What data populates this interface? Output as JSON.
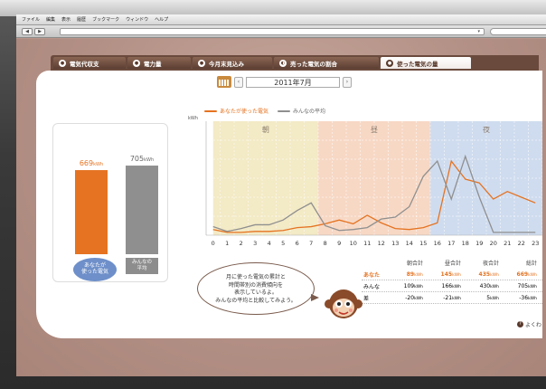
{
  "menu": [
    "ファイル",
    "編集",
    "表示",
    "履歴",
    "ブックマーク",
    "ウィンドウ",
    "ヘルプ"
  ],
  "toolbar": {
    "back": "◀",
    "forward": "▶",
    "address_arrow": "▾"
  },
  "tabs": [
    {
      "icon": "●",
      "label": "電気代収支"
    },
    {
      "icon": "●",
      "label": "電力量"
    },
    {
      "icon": "●",
      "label": "今月末見込み"
    },
    {
      "icon": "◐",
      "label": "売った電気の割合"
    },
    {
      "icon": "●",
      "label": "使った電気の量"
    }
  ],
  "month": {
    "prev": "‹",
    "label": "2011年7月",
    "next": "›"
  },
  "legend": {
    "you": "あなたが使った電気",
    "all": "みんなの平均"
  },
  "colors": {
    "you": "#e57321",
    "all": "#8f8f8f",
    "morning": "#f3eac6",
    "day": "#f7d8c5",
    "night": "#cfdcef"
  },
  "bars": {
    "you_value": "669",
    "all_value": "705",
    "unit": "kWh",
    "you_label": "あなたが\n使った電気",
    "all_label": "みんなの\n平均",
    "you_kwh": 669,
    "all_kwh": 705
  },
  "chart_data": {
    "type": "line",
    "ylabel": "kWh",
    "x": [
      0,
      1,
      2,
      3,
      4,
      5,
      6,
      7,
      8,
      9,
      10,
      11,
      12,
      13,
      14,
      15,
      16,
      17,
      18,
      19,
      20,
      21,
      22,
      23
    ],
    "periods": [
      {
        "label": "朝",
        "from": 0,
        "to": 7.5
      },
      {
        "label": "昼",
        "from": 7.5,
        "to": 15.5
      },
      {
        "label": "夜",
        "from": 15.5,
        "to": 23.5
      }
    ],
    "ylim": [
      0,
      12
    ],
    "series": [
      {
        "name": "あなたが使った電気",
        "values": [
          0.6,
          0.3,
          0.3,
          0.4,
          0.4,
          0.5,
          0.8,
          0.9,
          1.2,
          1.6,
          1.2,
          2.1,
          1.3,
          0.7,
          0.6,
          0.8,
          1.3,
          7.8,
          5.9,
          5.5,
          3.8,
          4.6,
          4.0,
          3.4
        ]
      },
      {
        "name": "みんなの平均",
        "values": [
          0.9,
          0.4,
          0.7,
          1.1,
          1.1,
          1.6,
          2.6,
          3.4,
          1.0,
          0.5,
          0.6,
          0.8,
          1.7,
          1.9,
          3.0,
          6.2,
          7.8,
          3.8,
          8.3,
          4.0,
          0.3,
          0.3,
          0.3,
          0.3
        ]
      }
    ]
  },
  "summary": {
    "head": [
      "",
      "朝合計",
      "昼合計",
      "夜合計",
      "総計"
    ],
    "rows": [
      {
        "key": "あなた",
        "v": [
          "89",
          "145",
          "435",
          "669"
        ]
      },
      {
        "key": "みんな",
        "v": [
          "109",
          "166",
          "430",
          "705"
        ]
      },
      {
        "key": "差",
        "v": [
          "-20",
          "-21",
          "5",
          "-36"
        ]
      }
    ],
    "unit": "kWh"
  },
  "bubble": {
    "lines": [
      "月に使った電気の累計と",
      "時間帯別の消費傾向を",
      "表示しているよ。",
      "みんなの平均と比較してみよう。"
    ]
  },
  "help": {
    "label": "よくわ"
  }
}
